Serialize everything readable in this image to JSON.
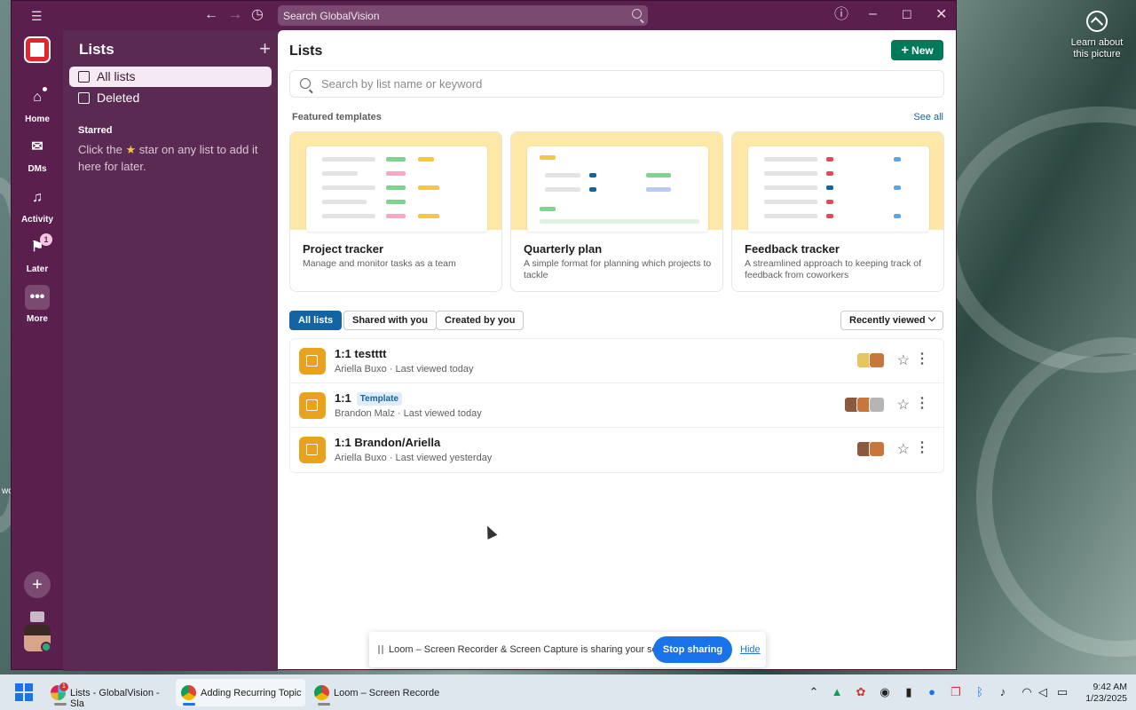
{
  "window": {
    "search_placeholder": "Search GlobalVision"
  },
  "rail": {
    "items": [
      {
        "label": "Home",
        "icon": "home-icon"
      },
      {
        "label": "DMs",
        "icon": "dms-icon"
      },
      {
        "label": "Activity",
        "icon": "bell-icon"
      },
      {
        "label": "Later",
        "icon": "bookmark-icon",
        "badge": "1"
      },
      {
        "label": "More",
        "icon": "more-icon"
      }
    ]
  },
  "sidebar": {
    "title": "Lists",
    "items": [
      {
        "label": "All lists"
      },
      {
        "label": "Deleted"
      }
    ],
    "starred_heading": "Starred",
    "starred_hint_pre": "Click the",
    "starred_hint_post": "star on any list to add it here for later."
  },
  "main": {
    "title": "Lists",
    "new_label": "New",
    "search_placeholder": "Search by list name or keyword",
    "featured_heading": "Featured templates",
    "see_all": "See all",
    "templates": [
      {
        "name": "Project tracker",
        "desc": "Manage and monitor tasks as a team"
      },
      {
        "name": "Quarterly plan",
        "desc": "A simple format for planning which projects to tackle"
      },
      {
        "name": "Feedback tracker",
        "desc": "A streamlined approach to keeping track of feedback from coworkers"
      }
    ],
    "filters": [
      "All lists",
      "Shared with you",
      "Created by you"
    ],
    "sort_label": "Recently viewed",
    "lists": [
      {
        "title": "1:1 testttt",
        "tag": "",
        "meta": "Ariella Buxo · Last viewed today"
      },
      {
        "title": "1:1",
        "tag": "Template",
        "meta": "Brandon Malz · Last viewed today"
      },
      {
        "title": "1:1 Brandon/Ariella",
        "tag": "",
        "meta": "Ariella Buxo · Last viewed yesterday"
      }
    ]
  },
  "share_bar": {
    "message": "Loom – Screen Recorder & Screen Capture is sharing your screen.",
    "stop": "Stop sharing",
    "hide": "Hide"
  },
  "desktop": {
    "learn_about": "Learn about this picture",
    "left_text": "wc"
  },
  "taskbar": {
    "tasks": [
      {
        "label": "Lists - GlobalVision - Sla",
        "badge": "1"
      },
      {
        "label": "Adding Recurring Topic"
      },
      {
        "label": "Loom – Screen Recorde"
      }
    ],
    "time": "9:42 AM",
    "date": "1/23/2025"
  },
  "colors": {
    "accent": "#5a1f4d",
    "new_button": "#007a5a",
    "primary_blue": "#1264a3",
    "list_icon": "#e8a21b"
  }
}
